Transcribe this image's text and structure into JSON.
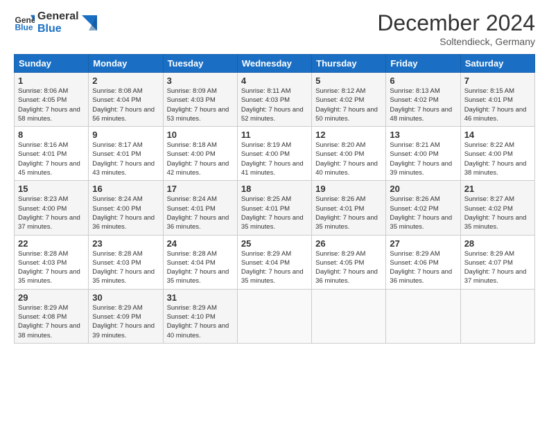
{
  "header": {
    "logo_line1": "General",
    "logo_line2": "Blue",
    "month_year": "December 2024",
    "location": "Soltendieck, Germany"
  },
  "weekdays": [
    "Sunday",
    "Monday",
    "Tuesday",
    "Wednesday",
    "Thursday",
    "Friday",
    "Saturday"
  ],
  "weeks": [
    [
      {
        "day": "1",
        "sunrise": "Sunrise: 8:06 AM",
        "sunset": "Sunset: 4:05 PM",
        "daylight": "Daylight: 7 hours and 58 minutes."
      },
      {
        "day": "2",
        "sunrise": "Sunrise: 8:08 AM",
        "sunset": "Sunset: 4:04 PM",
        "daylight": "Daylight: 7 hours and 56 minutes."
      },
      {
        "day": "3",
        "sunrise": "Sunrise: 8:09 AM",
        "sunset": "Sunset: 4:03 PM",
        "daylight": "Daylight: 7 hours and 53 minutes."
      },
      {
        "day": "4",
        "sunrise": "Sunrise: 8:11 AM",
        "sunset": "Sunset: 4:03 PM",
        "daylight": "Daylight: 7 hours and 52 minutes."
      },
      {
        "day": "5",
        "sunrise": "Sunrise: 8:12 AM",
        "sunset": "Sunset: 4:02 PM",
        "daylight": "Daylight: 7 hours and 50 minutes."
      },
      {
        "day": "6",
        "sunrise": "Sunrise: 8:13 AM",
        "sunset": "Sunset: 4:02 PM",
        "daylight": "Daylight: 7 hours and 48 minutes."
      },
      {
        "day": "7",
        "sunrise": "Sunrise: 8:15 AM",
        "sunset": "Sunset: 4:01 PM",
        "daylight": "Daylight: 7 hours and 46 minutes."
      }
    ],
    [
      {
        "day": "8",
        "sunrise": "Sunrise: 8:16 AM",
        "sunset": "Sunset: 4:01 PM",
        "daylight": "Daylight: 7 hours and 45 minutes."
      },
      {
        "day": "9",
        "sunrise": "Sunrise: 8:17 AM",
        "sunset": "Sunset: 4:01 PM",
        "daylight": "Daylight: 7 hours and 43 minutes."
      },
      {
        "day": "10",
        "sunrise": "Sunrise: 8:18 AM",
        "sunset": "Sunset: 4:00 PM",
        "daylight": "Daylight: 7 hours and 42 minutes."
      },
      {
        "day": "11",
        "sunrise": "Sunrise: 8:19 AM",
        "sunset": "Sunset: 4:00 PM",
        "daylight": "Daylight: 7 hours and 41 minutes."
      },
      {
        "day": "12",
        "sunrise": "Sunrise: 8:20 AM",
        "sunset": "Sunset: 4:00 PM",
        "daylight": "Daylight: 7 hours and 40 minutes."
      },
      {
        "day": "13",
        "sunrise": "Sunrise: 8:21 AM",
        "sunset": "Sunset: 4:00 PM",
        "daylight": "Daylight: 7 hours and 39 minutes."
      },
      {
        "day": "14",
        "sunrise": "Sunrise: 8:22 AM",
        "sunset": "Sunset: 4:00 PM",
        "daylight": "Daylight: 7 hours and 38 minutes."
      }
    ],
    [
      {
        "day": "15",
        "sunrise": "Sunrise: 8:23 AM",
        "sunset": "Sunset: 4:00 PM",
        "daylight": "Daylight: 7 hours and 37 minutes."
      },
      {
        "day": "16",
        "sunrise": "Sunrise: 8:24 AM",
        "sunset": "Sunset: 4:00 PM",
        "daylight": "Daylight: 7 hours and 36 minutes."
      },
      {
        "day": "17",
        "sunrise": "Sunrise: 8:24 AM",
        "sunset": "Sunset: 4:01 PM",
        "daylight": "Daylight: 7 hours and 36 minutes."
      },
      {
        "day": "18",
        "sunrise": "Sunrise: 8:25 AM",
        "sunset": "Sunset: 4:01 PM",
        "daylight": "Daylight: 7 hours and 35 minutes."
      },
      {
        "day": "19",
        "sunrise": "Sunrise: 8:26 AM",
        "sunset": "Sunset: 4:01 PM",
        "daylight": "Daylight: 7 hours and 35 minutes."
      },
      {
        "day": "20",
        "sunrise": "Sunrise: 8:26 AM",
        "sunset": "Sunset: 4:02 PM",
        "daylight": "Daylight: 7 hours and 35 minutes."
      },
      {
        "day": "21",
        "sunrise": "Sunrise: 8:27 AM",
        "sunset": "Sunset: 4:02 PM",
        "daylight": "Daylight: 7 hours and 35 minutes."
      }
    ],
    [
      {
        "day": "22",
        "sunrise": "Sunrise: 8:28 AM",
        "sunset": "Sunset: 4:03 PM",
        "daylight": "Daylight: 7 hours and 35 minutes."
      },
      {
        "day": "23",
        "sunrise": "Sunrise: 8:28 AM",
        "sunset": "Sunset: 4:03 PM",
        "daylight": "Daylight: 7 hours and 35 minutes."
      },
      {
        "day": "24",
        "sunrise": "Sunrise: 8:28 AM",
        "sunset": "Sunset: 4:04 PM",
        "daylight": "Daylight: 7 hours and 35 minutes."
      },
      {
        "day": "25",
        "sunrise": "Sunrise: 8:29 AM",
        "sunset": "Sunset: 4:04 PM",
        "daylight": "Daylight: 7 hours and 35 minutes."
      },
      {
        "day": "26",
        "sunrise": "Sunrise: 8:29 AM",
        "sunset": "Sunset: 4:05 PM",
        "daylight": "Daylight: 7 hours and 36 minutes."
      },
      {
        "day": "27",
        "sunrise": "Sunrise: 8:29 AM",
        "sunset": "Sunset: 4:06 PM",
        "daylight": "Daylight: 7 hours and 36 minutes."
      },
      {
        "day": "28",
        "sunrise": "Sunrise: 8:29 AM",
        "sunset": "Sunset: 4:07 PM",
        "daylight": "Daylight: 7 hours and 37 minutes."
      }
    ],
    [
      {
        "day": "29",
        "sunrise": "Sunrise: 8:29 AM",
        "sunset": "Sunset: 4:08 PM",
        "daylight": "Daylight: 7 hours and 38 minutes."
      },
      {
        "day": "30",
        "sunrise": "Sunrise: 8:29 AM",
        "sunset": "Sunset: 4:09 PM",
        "daylight": "Daylight: 7 hours and 39 minutes."
      },
      {
        "day": "31",
        "sunrise": "Sunrise: 8:29 AM",
        "sunset": "Sunset: 4:10 PM",
        "daylight": "Daylight: 7 hours and 40 minutes."
      },
      null,
      null,
      null,
      null
    ]
  ]
}
